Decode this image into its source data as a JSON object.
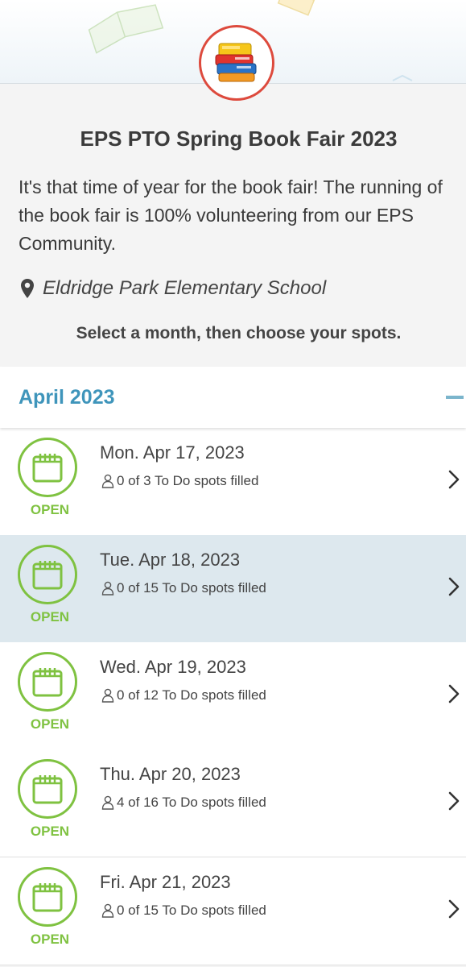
{
  "event": {
    "title": "EPS PTO Spring Book Fair 2023",
    "description": "It's that time of year for the book fair! The running of the book fair is 100% volunteering from our EPS Community.",
    "location": "Eldridge Park Elementary School",
    "instruction": "Select a month, then choose your spots."
  },
  "month": {
    "label": "April 2023"
  },
  "dates": [
    {
      "date": "Mon. Apr 17, 2023",
      "status": "OPEN",
      "spots": "0 of 3 To Do spots filled"
    },
    {
      "date": "Tue. Apr 18, 2023",
      "status": "OPEN",
      "spots": "0 of 15 To Do spots filled"
    },
    {
      "date": "Wed. Apr 19, 2023",
      "status": "OPEN",
      "spots": "0 of 12 To Do spots filled"
    },
    {
      "date": "Thu. Apr 20, 2023",
      "status": "OPEN",
      "spots": "4 of 16 To Do spots filled"
    },
    {
      "date": "Fri. Apr 21, 2023",
      "status": "OPEN",
      "spots": "0 of 15 To Do spots filled"
    }
  ],
  "colors": {
    "accent": "#3f95bb",
    "open": "#7fc241",
    "logo_ring": "#dd4a3d",
    "highlight_row": "#dde8ee"
  },
  "icons": {
    "logo": "books-stack-icon",
    "location": "map-pin-icon",
    "calendar": "calendar-icon",
    "person": "person-icon",
    "chevron": "chevron-right-icon",
    "collapse": "minus-icon"
  }
}
